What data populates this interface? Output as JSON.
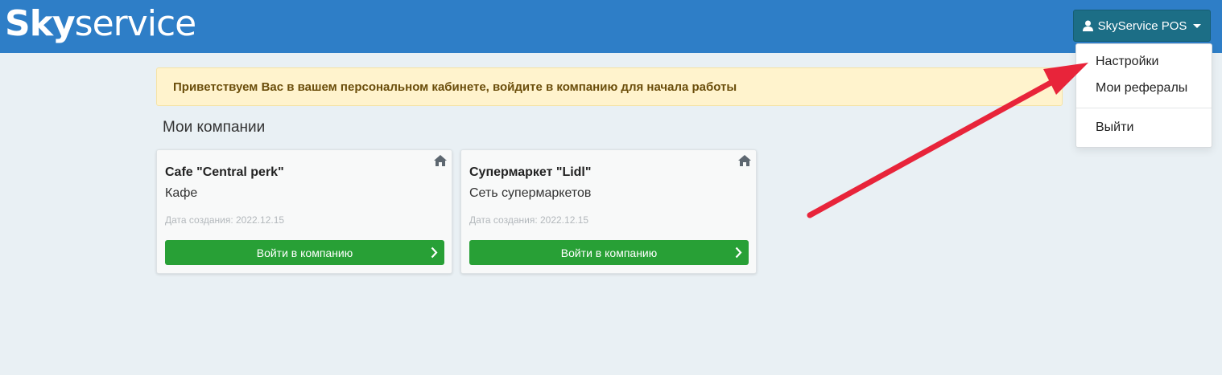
{
  "header": {
    "logo_bold": "Sky",
    "logo_light": "service",
    "user_label": "SkyService POS"
  },
  "dropdown": {
    "items": [
      "Настройки",
      "Мои рефералы",
      "Выйти"
    ]
  },
  "alert": {
    "text": "Приветствуем Вас в вашем персональном кабинете, войдите в компанию для начала работы"
  },
  "companies_title": "Мои компании",
  "companies": [
    {
      "name": "Cafe \"Central perk\"",
      "type": "Кафе",
      "created": "Дата создания: 2022.12.15",
      "enter_label": "Войти в компанию"
    },
    {
      "name": "Супермаркет \"Lidl\"",
      "type": "Сеть супермаркетов",
      "created": "Дата создания: 2022.12.15",
      "enter_label": "Войти в компанию"
    }
  ],
  "colors": {
    "header": "#2e7ec7",
    "user_button": "#1c6e86",
    "enter_button": "#28a036",
    "alert_bg": "#fff3cd",
    "annotation_arrow": "#e8243a"
  },
  "icons": {
    "user": "user-icon",
    "home": "home-icon",
    "chevron": "chevron-right-icon"
  }
}
